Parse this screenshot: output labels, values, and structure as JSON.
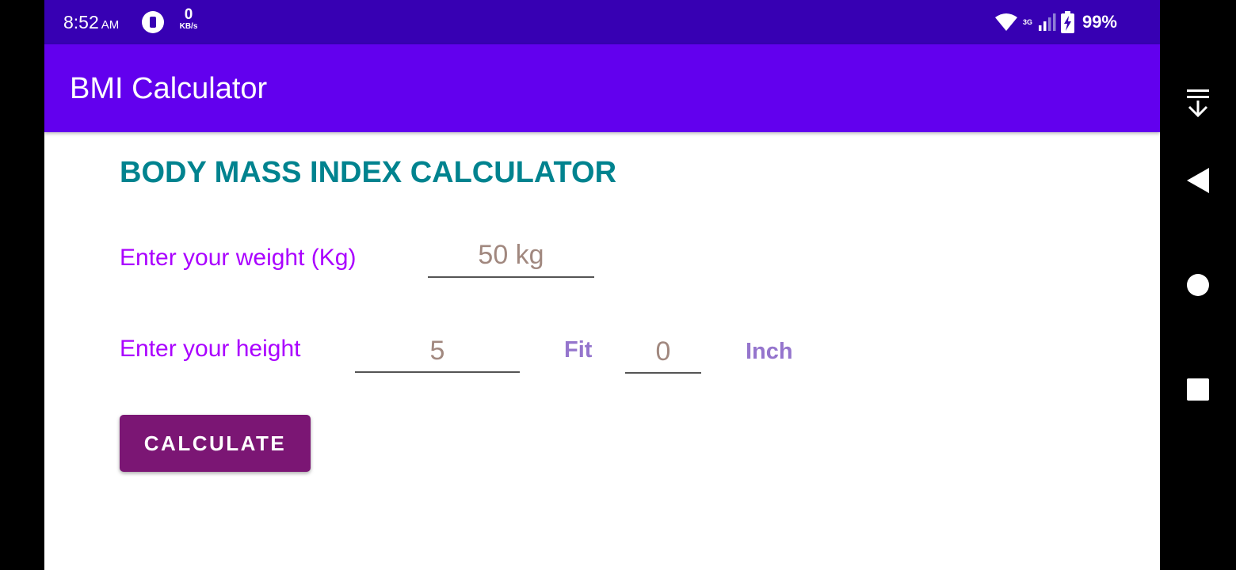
{
  "status_bar": {
    "time": "8:52",
    "ampm": "AM",
    "net_speed_value": "0",
    "net_speed_unit": "KB/s",
    "network_type": "3G",
    "battery_percent": "99%",
    "icons": [
      "app-notification-icon",
      "wifi-icon",
      "cell-signal-icon",
      "battery-charging-icon"
    ]
  },
  "app_bar": {
    "title": "BMI Calculator"
  },
  "main": {
    "heading": "BODY MASS INDEX CALCULATOR",
    "weight_label": "Enter your weight (Kg)",
    "weight_placeholder": "50 kg",
    "height_label": "Enter your height",
    "feet_placeholder": "5",
    "feet_unit": "Fit",
    "inch_placeholder": "0",
    "inch_unit": "Inch",
    "calculate_button": "CALCULATE"
  },
  "nav_bar": {
    "icons": [
      "collapse-icon",
      "back-icon",
      "home-icon",
      "recents-icon"
    ]
  },
  "colors": {
    "status_bar": "#3700b3",
    "app_bar": "#6200ee",
    "heading": "#00838f",
    "label": "#aa00ff",
    "unit_label": "#9575cd",
    "placeholder": "#a1887f",
    "button": "#7b1674"
  }
}
